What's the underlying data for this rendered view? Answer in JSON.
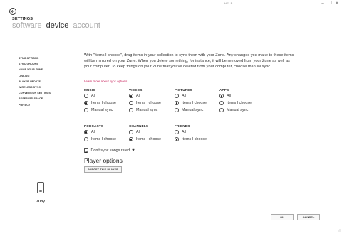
{
  "window": {
    "help": "HELP",
    "minimize_glyph": "–",
    "restore_glyph": "❐",
    "close_glyph": "✕"
  },
  "header": {
    "heading": "SETTINGS",
    "pivots": [
      "software",
      "device",
      "account"
    ],
    "active_pivot": "device"
  },
  "nav": {
    "items": [
      "SYNC OPTIONS",
      "SYNC GROUPS",
      "NAME YOUR ZUNE",
      "LINKING",
      "PLAYER UPDATE",
      "WIRELESS SYNC",
      "CONVERSION SETTINGS",
      "RESERVED SPACE",
      "PRIVACY"
    ],
    "active": "SYNC OPTIONS"
  },
  "device": {
    "name": "Zuny",
    "icon": "player-device-icon"
  },
  "content": {
    "intro": "With \"Items I choose\", drag items in your collection to sync them with your Zune. Any changes you make to these items will be mirrored on your Zune. When you delete something, for instance, it will be removed from your Zune as well as your computer. To keep things on your Zune that you've deleted from your computer, choose manual sync.",
    "learn_more": "Learn more about sync options",
    "groups": [
      {
        "title": "MUSIC",
        "options": [
          "All",
          "Items I choose",
          "Manual sync"
        ],
        "selected": 1
      },
      {
        "title": "VIDEOS",
        "options": [
          "All",
          "Items I choose",
          "Manual sync"
        ],
        "selected": 0
      },
      {
        "title": "PICTURES",
        "options": [
          "All",
          "Items I choose",
          "Manual sync"
        ],
        "selected": 1
      },
      {
        "title": "APPS",
        "options": [
          "All",
          "Items I choose",
          "Manual sync"
        ],
        "selected": 0
      },
      {
        "title": "PODCASTS",
        "options": [
          "All",
          "Items I choose"
        ],
        "selected": 0
      },
      {
        "title": "CHANNELS",
        "options": [
          "All",
          "Items I choose"
        ],
        "selected": 1
      },
      {
        "title": "FRIENDS",
        "options": [
          "All",
          "Items I choose"
        ],
        "selected": 1
      }
    ],
    "dont_sync_label": "Don't sync songs rated",
    "dont_sync_checked": true,
    "heart_glyph": "♥",
    "player_options_title": "Player options",
    "forget_button": "FORGET THIS PLAYER"
  },
  "footer": {
    "ok": "OK",
    "cancel": "CANCEL"
  },
  "colors": {
    "accent": "#c8225b"
  }
}
